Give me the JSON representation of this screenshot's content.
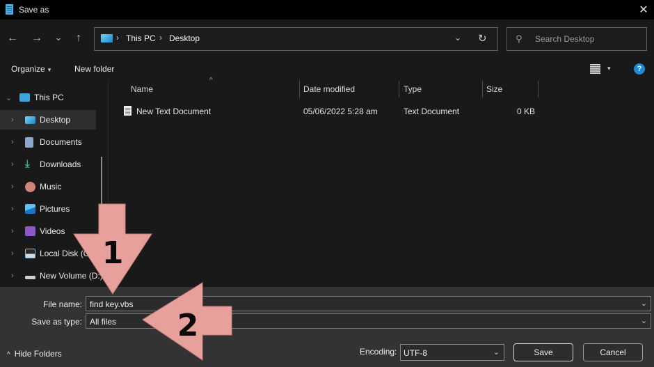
{
  "window": {
    "title": "Save as",
    "close_label": "✕"
  },
  "nav": {
    "back_icon": "←",
    "forward_icon": "→",
    "recent_icon": "⌄",
    "up_icon": "↑",
    "breadcrumb": [
      "This PC",
      "Desktop"
    ],
    "breadcrumb_sep": "›",
    "address_dropdown_icon": "⌄",
    "refresh_icon": "↻",
    "search_placeholder": "Search Desktop",
    "search_icon": "⚲"
  },
  "toolbar": {
    "organize_label": "Organize",
    "organize_caret": "▾",
    "new_folder_label": "New folder",
    "view_caret": "▾",
    "help_label": "?"
  },
  "sidebar": {
    "items": [
      {
        "label": "This PC",
        "icon": "monitor-icon",
        "chevron": "⌄",
        "color": "#3aa6e0",
        "selected": false
      },
      {
        "label": "Desktop",
        "icon": "desktop-icon",
        "chevron": "›",
        "color": "#3aa6e0",
        "selected": true
      },
      {
        "label": "Documents",
        "icon": "documents-icon",
        "chevron": "›",
        "color": "#8fa6c8",
        "selected": false
      },
      {
        "label": "Downloads",
        "icon": "download-icon",
        "chevron": "›",
        "color": "#3ab07a",
        "selected": false
      },
      {
        "label": "Music",
        "icon": "music-icon",
        "chevron": "›",
        "color": "#d4837a",
        "selected": false
      },
      {
        "label": "Pictures",
        "icon": "pictures-icon",
        "chevron": "›",
        "color": "#2e8fd8",
        "selected": false
      },
      {
        "label": "Videos",
        "icon": "videos-icon",
        "chevron": "›",
        "color": "#8b5ac8",
        "selected": false
      },
      {
        "label": "Local Disk (C:)",
        "icon": "local-disk-icon",
        "chevron": "›",
        "color": "#7fb8e0",
        "selected": false
      },
      {
        "label": "New Volume (D:)",
        "icon": "drive-icon",
        "chevron": "›",
        "color": "#d0d0d0",
        "selected": false
      }
    ]
  },
  "filelist": {
    "columns": [
      "Name",
      "Date modified",
      "Type",
      "Size"
    ],
    "sort_icon": "^",
    "rows": [
      {
        "name": "New Text Document",
        "date": "05/06/2022 5:28 am",
        "type": "Text Document",
        "size": "0 KB"
      }
    ]
  },
  "form": {
    "file_name_label": "File name:",
    "file_name_value": "find key.vbs",
    "type_label": "Save as type:",
    "type_value": "All files",
    "dropdown_icon": "⌄",
    "hide_folders_label": "Hide Folders",
    "hide_folders_caret": "^",
    "encoding_label": "Encoding:",
    "encoding_value": "UTF-8",
    "save_label": "Save",
    "cancel_label": "Cancel"
  },
  "annotations": {
    "arrow1_number": "1",
    "arrow2_number": "2",
    "arrow_color": "#e8a09c"
  }
}
